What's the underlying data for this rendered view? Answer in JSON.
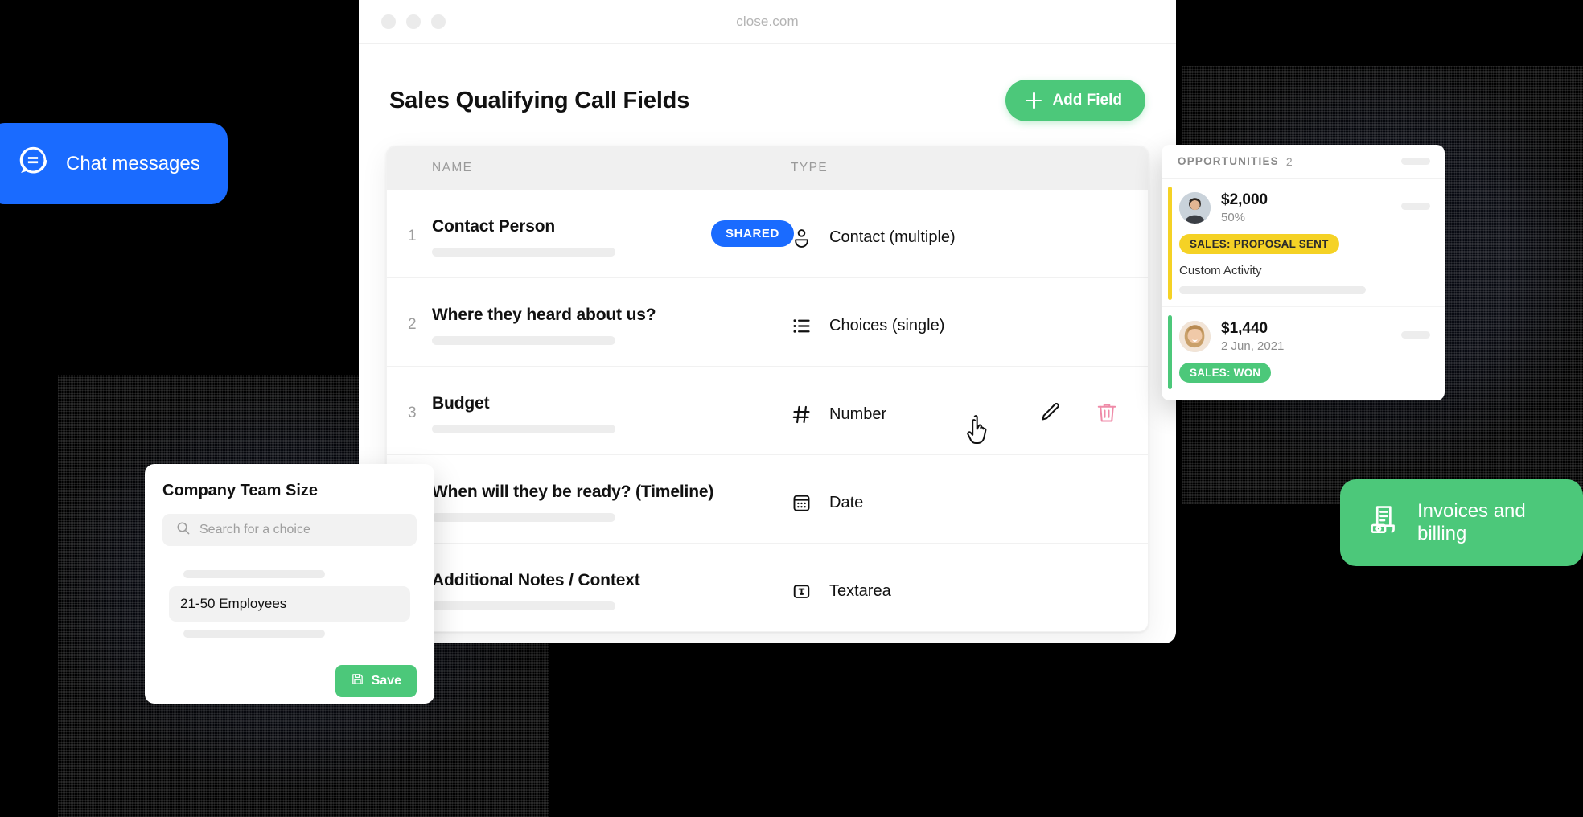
{
  "browser": {
    "url": "close.com",
    "traffic_lights": [
      "close-dot",
      "minimize-dot",
      "zoom-dot"
    ]
  },
  "page": {
    "title": "Sales Qualifying Call Fields",
    "add_field_label": "Add Field"
  },
  "table": {
    "headers": {
      "name": "NAME",
      "type": "TYPE"
    },
    "rows": [
      {
        "index": "1",
        "name": "Contact Person",
        "badge": "SHARED",
        "type": "Contact (multiple)",
        "icon": "contact-icon"
      },
      {
        "index": "2",
        "name": "Where they heard about us?",
        "badge": "",
        "type": "Choices (single)",
        "icon": "list-icon"
      },
      {
        "index": "3",
        "name": "Budget",
        "badge": "",
        "type": "Number",
        "icon": "hash-icon"
      },
      {
        "index": "",
        "name": "When will they be ready? (Timeline)",
        "badge": "",
        "type": "Date",
        "icon": "calendar-icon"
      },
      {
        "index": "",
        "name": "Additional Notes / Context",
        "badge": "",
        "type": "Textarea",
        "icon": "textarea-icon"
      }
    ],
    "actions": {
      "edit": "edit-field",
      "delete": "delete-field"
    }
  },
  "pills": {
    "chat": {
      "label": "Chat messages",
      "color": "#1a6bff"
    },
    "invoice": {
      "label": "Invoices and billing",
      "color": "#4cc87a"
    }
  },
  "opportunities": {
    "header_label": "OPPORTUNITIES",
    "count": "2",
    "items": [
      {
        "amount": "$2,000",
        "sub": "50%",
        "status": "SALES: PROPOSAL SENT",
        "status_bg": "#f5d225",
        "status_color": "#2b2b2b",
        "bar_color": "#f5d225",
        "activity": "Custom Activity"
      },
      {
        "amount": "$1,440",
        "sub": "2 Jun, 2021",
        "status": "SALES: WON",
        "status_bg": "#4cc87a",
        "status_color": "#ffffff",
        "bar_color": "#4cc87a",
        "activity": ""
      }
    ]
  },
  "team_size": {
    "title": "Company Team Size",
    "search_placeholder": "Search for a choice",
    "search_value": "",
    "option": "21-50 Employees",
    "save_label": "Save"
  },
  "colors": {
    "accent_green": "#4cc87a",
    "accent_blue": "#1a6bff",
    "warning_yellow": "#f5d225",
    "danger_pink": "#ef8ba8",
    "background": "#000000"
  }
}
